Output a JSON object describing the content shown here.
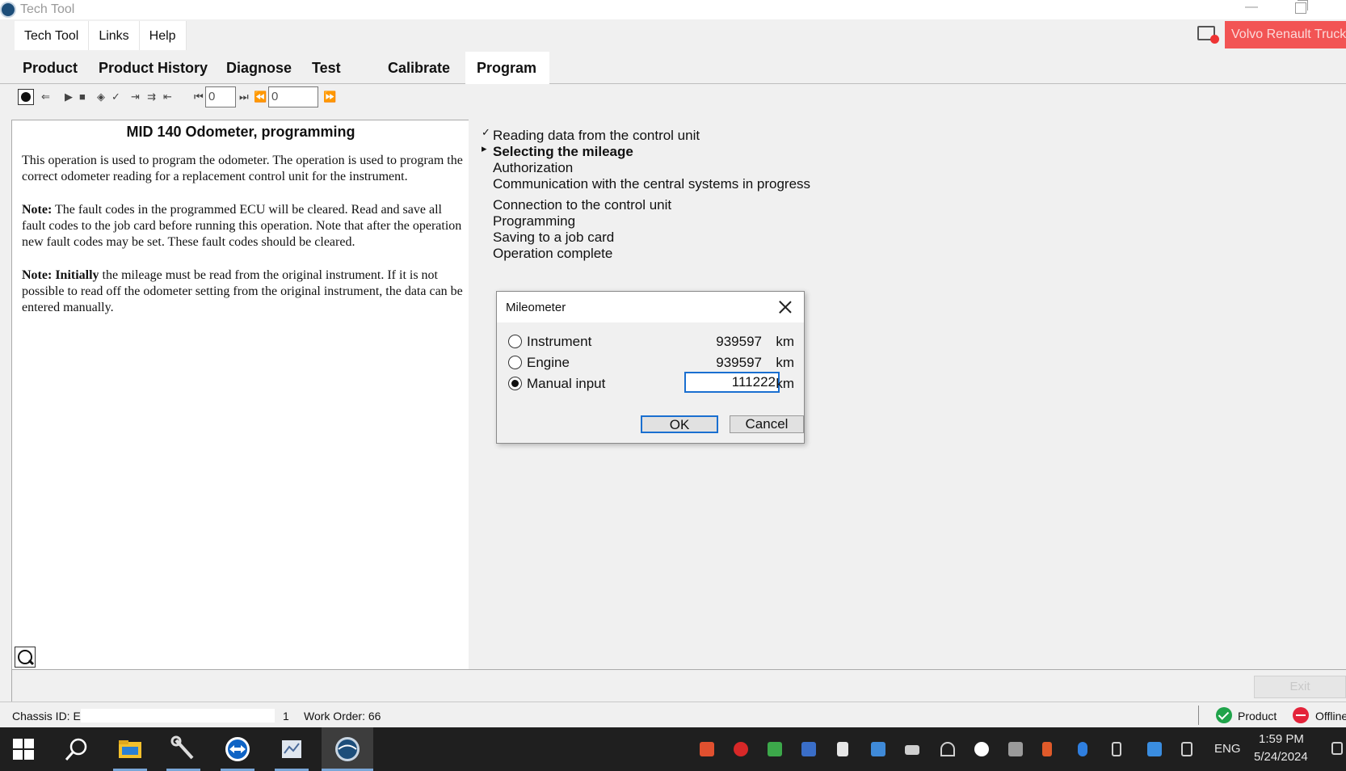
{
  "window": {
    "title": "Tech Tool"
  },
  "menu": {
    "items": [
      "Tech Tool",
      "Links",
      "Help"
    ]
  },
  "brand": {
    "label": "Volvo Renault Truck"
  },
  "tabs": [
    "Product",
    "Product History",
    "Diagnose",
    "Test",
    "Calibrate",
    "Program"
  ],
  "toolbar": {
    "counter1": "0",
    "counter2": "0"
  },
  "document": {
    "title": "MID 140 Odometer, programming",
    "para1": "This operation is used to program the odometer. The operation is used to program the correct odometer reading for a replacement control unit for the instrument.",
    "note1_label": "Note:",
    "note1_text": " The fault codes in the programmed ECU will be cleared. Read and save all fault codes to the job card before running this operation. Note that after the operation new fault codes may be set. These fault codes should be cleared.",
    "note2_label": "Note: Initially",
    "note2_text": " the mileage must be read from the original instrument. If it is not possible to read off the odometer setting from the original instrument, the data can be entered manually."
  },
  "steps": [
    {
      "label": "Reading data from the control unit",
      "mark": "✓",
      "bold": false
    },
    {
      "label": "Selecting the mileage",
      "mark": "▸",
      "bold": true
    },
    {
      "label": "Authorization",
      "mark": "",
      "bold": false
    },
    {
      "label": "Communication with the central systems in progress",
      "mark": "",
      "bold": false
    },
    {
      "label": "Connection to the control unit",
      "mark": "",
      "bold": false
    },
    {
      "label": "Programming",
      "mark": "",
      "bold": false
    },
    {
      "label": "Saving to a job card",
      "mark": "",
      "bold": false
    },
    {
      "label": "Operation complete",
      "mark": "",
      "bold": false
    }
  ],
  "dialog": {
    "title": "Mileometer",
    "rows": [
      {
        "label": "Instrument",
        "value": "939597",
        "unit": "km",
        "checked": false
      },
      {
        "label": "Engine",
        "value": "939597",
        "unit": "km",
        "checked": false
      },
      {
        "label": "Manual input",
        "value": "111222",
        "unit": "km",
        "checked": true
      }
    ],
    "ok": "OK",
    "cancel": "Cancel"
  },
  "bottom": {
    "exit": "Exit"
  },
  "status": {
    "chassis_label": "Chassis ID: E",
    "chassis_num": "1",
    "work_order": "Work Order: 66",
    "product": "Product",
    "offline": "Offline"
  },
  "taskbar": {
    "lang": "ENG",
    "time": "1:59 PM",
    "date": "5/24/2024"
  },
  "colors": {
    "brand": "#f25454",
    "accent": "#1a6fd0",
    "ok": "#1fa34a",
    "offline": "#e4233a",
    "taskbar": "#1f1f1f"
  }
}
